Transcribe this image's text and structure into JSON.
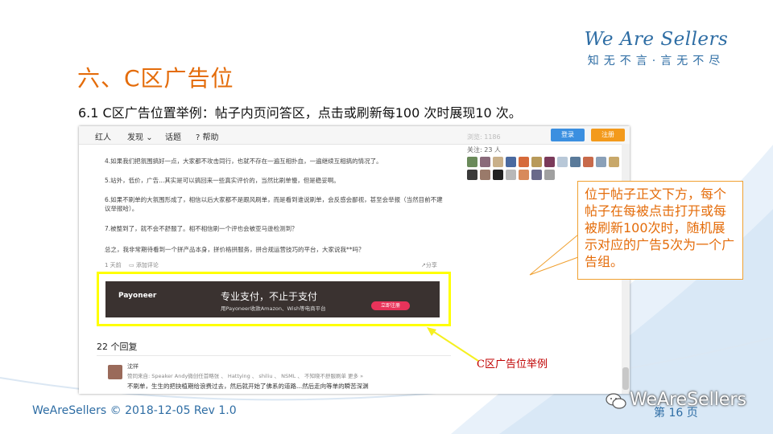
{
  "brand": {
    "name": "We Are Sellers",
    "tagline": "知无不言·言无不尽"
  },
  "slide": {
    "title": "六、C区广告位",
    "subtitle": "6.1  C区广告位置举例：帖子内页问答区，点击或刷新每100 次时展现10 次。"
  },
  "screenshot": {
    "nav": {
      "items": [
        "红人",
        "发现",
        "话题",
        "帮助"
      ],
      "login": "登录",
      "register": "注册"
    },
    "side": {
      "views": "浏览: 1186",
      "followers": "关注: 23 人"
    },
    "paragraphs": [
      "4.如果我们把氛围搞好一点，大家都不攻击同行，也就不存在一遍互相扑血，一遍继续互相搞的情况了。",
      "5.站外，低价，广告...其实是可以搞回来一些真实评价的，当然比刷单慢，但是稳妥啊。",
      "6.如果不刷单的大氛围形成了，相信以后大家都不是跟风刷单，而是看到谁说刷单，会反感会鄙视，甚至会举报（当然目前不建议举报哈）。",
      "7.被整到了，就不会不舒服了。相不相信刷一个评也会被亚马逊检测到？",
      "总之，我非常期待看到一个拼产品本身，拼价格拼服务，拼合规运营技巧的平台，大家说我**吗？"
    ],
    "post_meta": {
      "time": "1 天前",
      "comment": "添加评论",
      "share": "分享"
    },
    "ad": {
      "logo": "Payoneer",
      "headline": "专业支付，不止于支付",
      "sub": "用Payoneer收款Amazon、Wish等电商平台",
      "cta": "立即注册"
    },
    "reply_count": "22 个回复",
    "reply": {
      "user": "沈祥",
      "likes": "赞同来自: Speaker Andy微创任首略张 、 Hattying 、 shiliu 、 NSML 、 不知晓不舒服刷单 更多 »",
      "text": "不刷单，生生的把抉植期给浪费过去，然后就开始了佛系的道路...然后走向等单的瞬苦深渊"
    }
  },
  "callout": {
    "text": "位于帖子正文下方，每个帖子在每被点击打开或每被刷新100次时，随机展示对应的广告5次为一个广告组。"
  },
  "label": {
    "text": "C区广告位举例"
  },
  "footer": {
    "left": "WeAreSellers © 2018-12-05  Rev 1.0",
    "right": "第 16 页",
    "wechat": "WeAreSellers"
  },
  "colors": {
    "title_orange": "#e46c0a",
    "brand_blue": "#2e6da4",
    "highlight_yellow": "#ffff00",
    "label_red": "#c00000"
  },
  "icons": [
    "wechat-icon",
    "chevron-down-icon",
    "help-icon",
    "comment-icon",
    "share-icon",
    "arrow-icon"
  ]
}
